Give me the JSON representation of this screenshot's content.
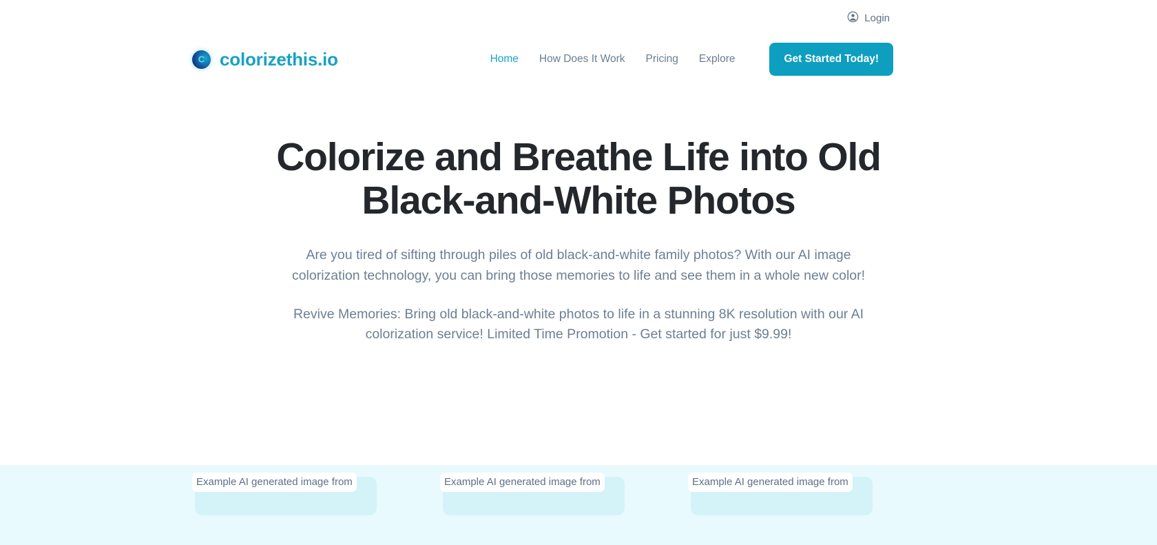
{
  "utility": {
    "login_label": "Login",
    "account_icon": "account-circle-icon"
  },
  "brand": {
    "name": "colorizethis.io",
    "mark_glyph": "C",
    "mark_icon": "colorizethis-logo-icon"
  },
  "nav": {
    "items": [
      {
        "label": "Home",
        "active": true
      },
      {
        "label": "How Does It Work",
        "active": false
      },
      {
        "label": "Pricing",
        "active": false
      },
      {
        "label": "Explore",
        "active": false
      }
    ],
    "cta_label": "Get Started Today!"
  },
  "hero": {
    "title": "Colorize and Breathe Life into Old Black-and-White Photos",
    "paragraph_1": "Are you tired of sifting through piles of old black-and-white family photos? With our AI image colorization technology, you can bring those memories to life and see them in a whole new color!",
    "paragraph_2": "Revive Memories: Bring old black-and-white photos to life in a stunning 8K resolution with our AI colorization service! Limited Time Promotion - Get started for just $9.99!"
  },
  "examples": {
    "cards": [
      {
        "alt_text": "Example AI generated image from"
      },
      {
        "alt_text": "Example AI generated image from"
      },
      {
        "alt_text": "Example AI generated image from"
      }
    ]
  },
  "colors": {
    "accent_teal": "#0e9ec0",
    "brand_teal": "#18a2c4",
    "muted_text": "#6c7f93",
    "heading": "#24272b",
    "examples_background": "#e8fafd",
    "placeholder_block": "#d4f3f9"
  }
}
